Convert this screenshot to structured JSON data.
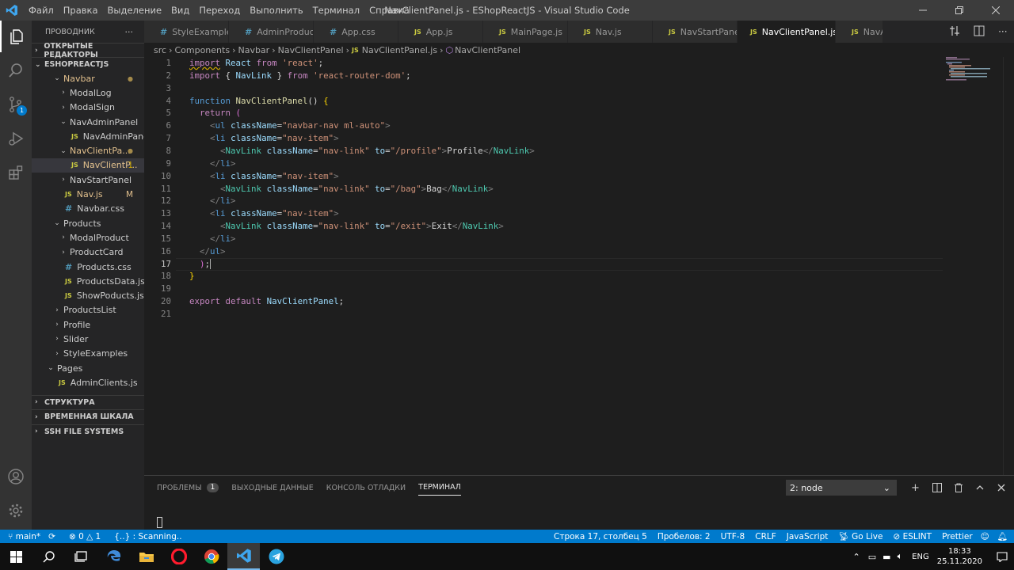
{
  "window": {
    "title": "NavClientPanel.js - EShopReactJS - Visual Studio Code",
    "menu": [
      "Файл",
      "Правка",
      "Выделение",
      "Вид",
      "Переход",
      "Выполнить",
      "Терминал",
      "Справка"
    ]
  },
  "activity_bar": {
    "items": [
      "explorer-icon",
      "search-icon",
      "source-control-icon",
      "run-debug-icon",
      "extensions-icon",
      "account-icon",
      "settings-gear-icon"
    ],
    "scm_badge": "1"
  },
  "explorer": {
    "header": "ПРОВОДНИК",
    "more": "···",
    "open_editors": "ОТКРЫТЫЕ РЕДАКТОРЫ",
    "project": "ESHOPREACTJS",
    "tree": [
      {
        "label": "Navbar",
        "type": "folder",
        "open": true,
        "depth": 0,
        "color": "#e2c08d",
        "badge": "●",
        "badge_color": "#a48a4a"
      },
      {
        "label": "ModalLog",
        "type": "folder",
        "open": false,
        "depth": 1
      },
      {
        "label": "ModalSign",
        "type": "folder",
        "open": false,
        "depth": 1
      },
      {
        "label": "NavAdminPanel",
        "type": "folder",
        "open": true,
        "depth": 1
      },
      {
        "label": "NavAdminPanel.js",
        "type": "js",
        "depth": 2
      },
      {
        "label": "NavClientPa...",
        "type": "folder",
        "open": true,
        "depth": 1,
        "color": "#e2c08d",
        "badge": "●",
        "badge_color": "#a48a4a"
      },
      {
        "label": "NavClientP...",
        "type": "js",
        "depth": 2,
        "color": "#e2c08d",
        "badge": "1",
        "badge_color": "#cca700",
        "selected": true
      },
      {
        "label": "NavStartPanel",
        "type": "folder",
        "open": false,
        "depth": 1
      },
      {
        "label": "Nav.js",
        "type": "js",
        "depth": 1,
        "color": "#e2c08d",
        "badge": "M",
        "badge_color": "#e2c08d"
      },
      {
        "label": "Navbar.css",
        "type": "css",
        "depth": 1
      },
      {
        "label": "Products",
        "type": "folder",
        "open": true,
        "depth": 0
      },
      {
        "label": "ModalProduct",
        "type": "folder",
        "open": false,
        "depth": 1
      },
      {
        "label": "ProductCard",
        "type": "folder",
        "open": false,
        "depth": 1
      },
      {
        "label": "Products.css",
        "type": "css",
        "depth": 1
      },
      {
        "label": "ProductsData.js",
        "type": "js",
        "depth": 1
      },
      {
        "label": "ShowPoducts.js",
        "type": "js",
        "depth": 1
      },
      {
        "label": "ProductsList",
        "type": "folder",
        "open": false,
        "depth": 0
      },
      {
        "label": "Profile",
        "type": "folder",
        "open": false,
        "depth": 0
      },
      {
        "label": "Slider",
        "type": "folder",
        "open": false,
        "depth": 0
      },
      {
        "label": "StyleExamples",
        "type": "folder",
        "open": false,
        "depth": 0
      },
      {
        "label": "Pages",
        "type": "folder",
        "open": true,
        "depth": -1
      },
      {
        "label": "AdminClients.js",
        "type": "js",
        "depth": 0
      }
    ],
    "sections": [
      "СТРУКТУРА",
      "ВРЕМЕННАЯ ШКАЛА",
      "SSH FILE SYSTEMS"
    ]
  },
  "tabs": [
    {
      "label": "StyleExamples.css",
      "type": "css"
    },
    {
      "label": "AdminProducts.css",
      "type": "css"
    },
    {
      "label": "App.css",
      "type": "css"
    },
    {
      "label": "App.js",
      "type": "js"
    },
    {
      "label": "MainPage.js",
      "type": "js"
    },
    {
      "label": "Nav.js",
      "type": "js"
    },
    {
      "label": "NavStartPanel.js",
      "type": "js"
    },
    {
      "label": "NavClientPanel.js",
      "type": "js",
      "active": true
    },
    {
      "label": "NavA",
      "type": "js"
    }
  ],
  "breadcrumbs": [
    "src",
    "Components",
    "Navbar",
    "NavClientPanel",
    "NavClientPanel.js",
    "NavClientPanel"
  ],
  "editor": {
    "current_line": 17,
    "lines": [
      [
        [
          "k",
          "import"
        ],
        [
          "w",
          " "
        ],
        [
          "v",
          "React"
        ],
        [
          "w",
          " "
        ],
        [
          "k",
          "from"
        ],
        [
          "w",
          " "
        ],
        [
          "s",
          "'react'"
        ],
        [
          "w",
          ";"
        ]
      ],
      [
        [
          "k",
          "import"
        ],
        [
          "w",
          " "
        ],
        [
          "w",
          "{ "
        ],
        [
          "v",
          "NavLink"
        ],
        [
          "w",
          " } "
        ],
        [
          "k",
          "from"
        ],
        [
          "w",
          " "
        ],
        [
          "s",
          "'react-router-dom'"
        ],
        [
          "w",
          ";"
        ]
      ],
      [],
      [
        [
          "kb",
          "function"
        ],
        [
          "w",
          " "
        ],
        [
          "f",
          "NavClientPanel"
        ],
        [
          "w",
          "() "
        ],
        [
          "y",
          "{"
        ]
      ],
      [
        [
          "w",
          "  "
        ],
        [
          "k",
          "return"
        ],
        [
          "w",
          " "
        ],
        [
          "pk",
          "("
        ]
      ],
      [
        [
          "w",
          "    "
        ],
        [
          "p",
          "<"
        ],
        [
          "t",
          "ul"
        ],
        [
          "w",
          " "
        ],
        [
          "v",
          "className"
        ],
        [
          "w",
          "="
        ],
        [
          "s",
          "\"navbar-nav ml-auto\""
        ],
        [
          "p",
          ">"
        ]
      ],
      [
        [
          "w",
          "    "
        ],
        [
          "p",
          "<"
        ],
        [
          "t",
          "li"
        ],
        [
          "w",
          " "
        ],
        [
          "v",
          "className"
        ],
        [
          "w",
          "="
        ],
        [
          "s",
          "\"nav-item\""
        ],
        [
          "p",
          ">"
        ]
      ],
      [
        [
          "w",
          "      "
        ],
        [
          "p",
          "<"
        ],
        [
          "c",
          "NavLink"
        ],
        [
          "w",
          " "
        ],
        [
          "v",
          "className"
        ],
        [
          "w",
          "="
        ],
        [
          "s",
          "\"nav-link\""
        ],
        [
          "w",
          " "
        ],
        [
          "v",
          "to"
        ],
        [
          "w",
          "="
        ],
        [
          "s",
          "\"/profile\""
        ],
        [
          "p",
          ">"
        ],
        [
          "w",
          "Profile"
        ],
        [
          "p",
          "</"
        ],
        [
          "c",
          "NavLink"
        ],
        [
          "p",
          ">"
        ]
      ],
      [
        [
          "w",
          "    "
        ],
        [
          "p",
          "</"
        ],
        [
          "t",
          "li"
        ],
        [
          "p",
          ">"
        ]
      ],
      [
        [
          "w",
          "    "
        ],
        [
          "p",
          "<"
        ],
        [
          "t",
          "li"
        ],
        [
          "w",
          " "
        ],
        [
          "v",
          "className"
        ],
        [
          "w",
          "="
        ],
        [
          "s",
          "\"nav-item\""
        ],
        [
          "p",
          ">"
        ]
      ],
      [
        [
          "w",
          "      "
        ],
        [
          "p",
          "<"
        ],
        [
          "c",
          "NavLink"
        ],
        [
          "w",
          " "
        ],
        [
          "v",
          "className"
        ],
        [
          "w",
          "="
        ],
        [
          "s",
          "\"nav-link\""
        ],
        [
          "w",
          " "
        ],
        [
          "v",
          "to"
        ],
        [
          "w",
          "="
        ],
        [
          "s",
          "\"/bag\""
        ],
        [
          "p",
          ">"
        ],
        [
          "w",
          "Bag"
        ],
        [
          "p",
          "</"
        ],
        [
          "c",
          "NavLink"
        ],
        [
          "p",
          ">"
        ]
      ],
      [
        [
          "w",
          "    "
        ],
        [
          "p",
          "</"
        ],
        [
          "t",
          "li"
        ],
        [
          "p",
          ">"
        ]
      ],
      [
        [
          "w",
          "    "
        ],
        [
          "p",
          "<"
        ],
        [
          "t",
          "li"
        ],
        [
          "w",
          " "
        ],
        [
          "v",
          "className"
        ],
        [
          "w",
          "="
        ],
        [
          "s",
          "\"nav-item\""
        ],
        [
          "p",
          ">"
        ]
      ],
      [
        [
          "w",
          "      "
        ],
        [
          "p",
          "<"
        ],
        [
          "c",
          "NavLink"
        ],
        [
          "w",
          " "
        ],
        [
          "v",
          "className"
        ],
        [
          "w",
          "="
        ],
        [
          "s",
          "\"nav-link\""
        ],
        [
          "w",
          " "
        ],
        [
          "v",
          "to"
        ],
        [
          "w",
          "="
        ],
        [
          "s",
          "\"/exit\""
        ],
        [
          "p",
          ">"
        ],
        [
          "w",
          "Exit"
        ],
        [
          "p",
          "</"
        ],
        [
          "c",
          "NavLink"
        ],
        [
          "p",
          ">"
        ]
      ],
      [
        [
          "w",
          "    "
        ],
        [
          "p",
          "</"
        ],
        [
          "t",
          "li"
        ],
        [
          "p",
          ">"
        ]
      ],
      [
        [
          "w",
          "  "
        ],
        [
          "p",
          "</"
        ],
        [
          "t",
          "ul"
        ],
        [
          "p",
          ">"
        ]
      ],
      [
        [
          "w",
          "  "
        ],
        [
          "pk",
          ")"
        ],
        [
          "w",
          ";"
        ]
      ],
      [
        [
          "y",
          "}"
        ]
      ],
      [],
      [
        [
          "k",
          "export"
        ],
        [
          "w",
          " "
        ],
        [
          "k",
          "default"
        ],
        [
          "w",
          " "
        ],
        [
          "v",
          "NavClientPanel"
        ],
        [
          "w",
          ";"
        ]
      ],
      []
    ]
  },
  "panel": {
    "tabs": [
      "ПРОБЛЕМЫ",
      "ВЫХОДНЫЕ ДАННЫЕ",
      "КОНСОЛЬ ОТЛАДКИ",
      "ТЕРМИНАЛ"
    ],
    "problems_count": "1",
    "active_tab": 3,
    "terminal_select": "2: node"
  },
  "status": {
    "branch": "main*",
    "errors": "0",
    "warnings": "1",
    "scanning": "{..} : Scanning..",
    "position": "Строка 17, столбец 5",
    "spaces": "Пробелов: 2",
    "encoding": "UTF-8",
    "eol": "CRLF",
    "language": "JavaScript",
    "golive": "Go Live",
    "eslint": "ESLINT",
    "prettier": "Prettier"
  },
  "taskbar": {
    "apps": [
      "windows-start-icon",
      "search-icon",
      "task-view-icon",
      "edge-icon",
      "file-explorer-icon",
      "opera-icon",
      "chrome-icon",
      "vscode-icon",
      "telegram-icon"
    ],
    "lang": "ENG",
    "time": "18:33",
    "date": "25.11.2020"
  }
}
